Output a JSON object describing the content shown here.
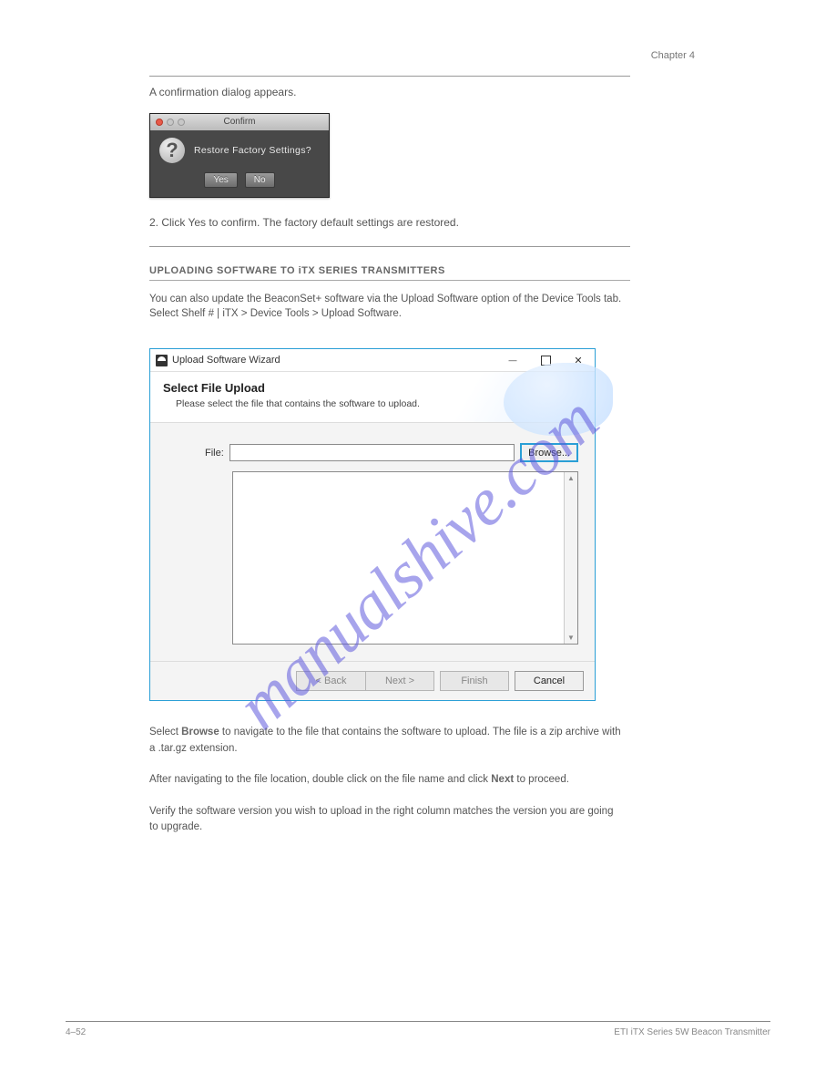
{
  "page": {
    "header_chapter": "Chapter  4",
    "intro_text": "A confirmation dialog appears.",
    "confirm": {
      "title": "Confirm",
      "message": "Restore  Factory Settings?",
      "yes": "Yes",
      "no": "No"
    },
    "step2": "2.  Click  Yes  to confirm.  The factory default settings are restored.",
    "section_heading": "UPLOADING  SOFTWARE  TO  iTX  SERIES  TRANSMITTERS",
    "section_body": "You can also update the BeaconSet+ software via the  Upload Software  option of the  Device Tools  tab.  Select  Shelf # | iTX  >  Device Tools  >  Upload Software.",
    "wizard": {
      "title": "Upload Software Wizard",
      "heading": "Select File Upload",
      "sub": "Please select the file that contains the software to upload.",
      "file_label": "File:",
      "file_value": "",
      "browse": "Browse...",
      "back": "< Back",
      "next": "Next >",
      "finish": "Finish",
      "cancel": "Cancel"
    },
    "para": {
      "line1_prefix": "Select ",
      "line1_term": "Browse",
      "line1_rest": " to navigate to the file that contains the software to upload.  The file is a zip archive with a .tar.gz extension.",
      "line2_prefix": "After navigating to the file location,  double click on the file name and click ",
      "line2_term": "Next",
      "line2_rest": " to proceed.",
      "line3": "Verify the software version you wish to upload in the right column matches the version you are going to upgrade."
    },
    "footer": {
      "left": "4–52",
      "right": "ETI  iTX Series 5W Beacon Transmitter"
    },
    "watermark": "manualshive.com"
  }
}
